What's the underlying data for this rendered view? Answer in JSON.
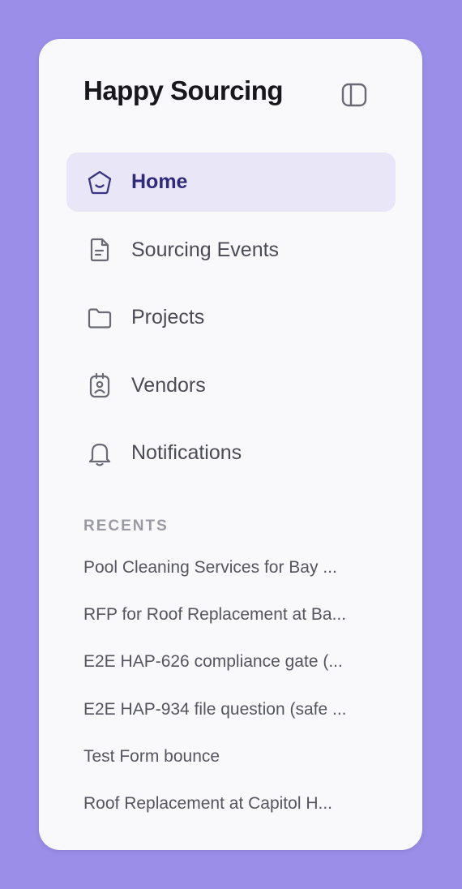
{
  "app": {
    "title": "Happy Sourcing",
    "collapse_icon": "sidebar-toggle-icon"
  },
  "colors": {
    "background": "#9b8ee8",
    "panel": "#f9f9fb",
    "active_bg": "#e8e6f7",
    "active_text": "#2f2a7a",
    "text": "#4b4b55",
    "muted": "#9a9aa3"
  },
  "nav": {
    "items": [
      {
        "label": "Home",
        "icon": "home-icon",
        "active": true
      },
      {
        "label": "Sourcing Events",
        "icon": "document-icon",
        "active": false
      },
      {
        "label": "Projects",
        "icon": "folder-icon",
        "active": false
      },
      {
        "label": "Vendors",
        "icon": "vendor-badge-icon",
        "active": false
      },
      {
        "label": "Notifications",
        "icon": "bell-icon",
        "active": false
      }
    ]
  },
  "recents": {
    "heading": "RECENTS",
    "items": [
      "Pool Cleaning Services for Bay ...",
      "RFP for Roof Replacement at Ba...",
      "E2E HAP-626 compliance gate (...",
      "E2E HAP-934 file question (safe ...",
      "Test Form bounce",
      "Roof Replacement at Capitol H..."
    ]
  }
}
